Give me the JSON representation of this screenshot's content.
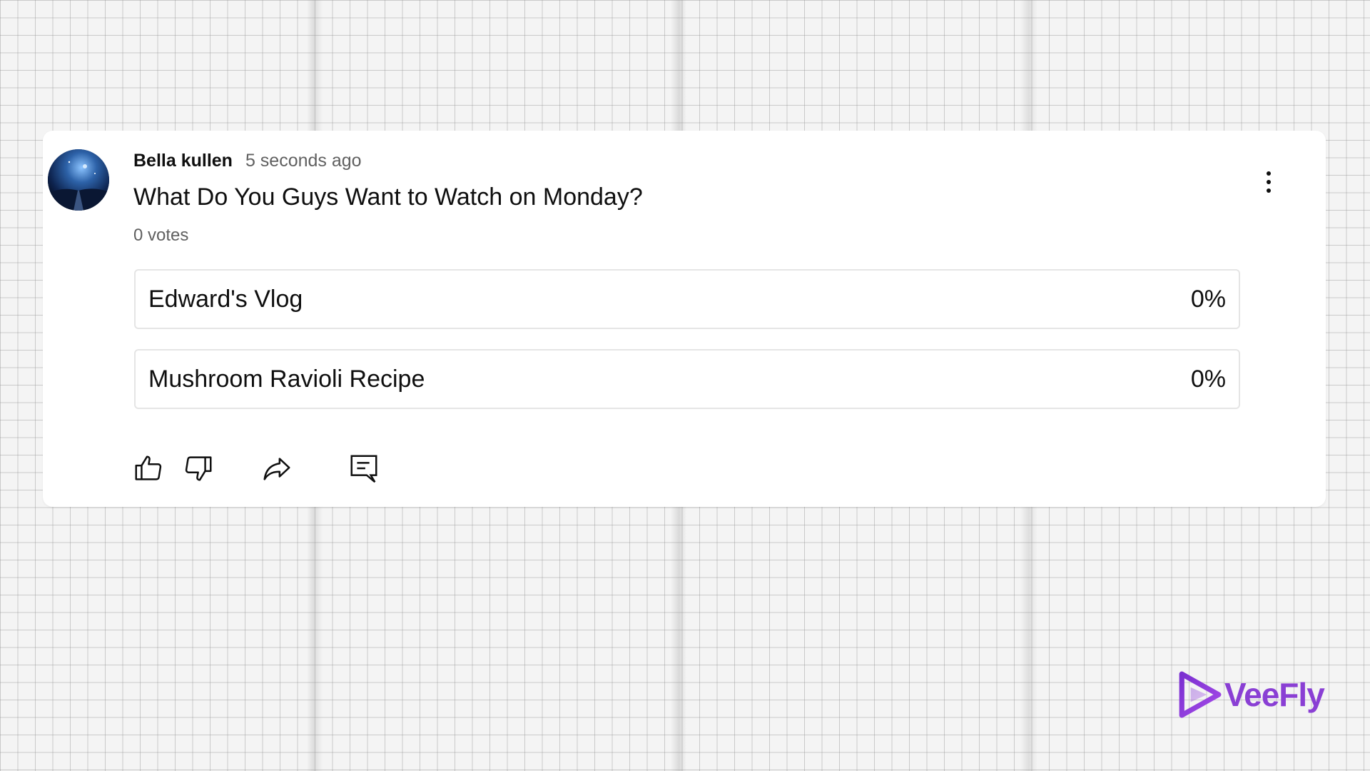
{
  "post": {
    "author": "Bella kullen",
    "timestamp": "5 seconds ago",
    "question": "What Do You Guys Want to Watch on Monday?",
    "votes": "0 votes",
    "options": [
      {
        "label": "Edward's Vlog",
        "percent": "0%"
      },
      {
        "label": "Mushroom Ravioli Recipe",
        "percent": "0%"
      }
    ]
  },
  "actions": {
    "icons": [
      "thumbs-up-icon",
      "thumbs-down-icon",
      "share-icon",
      "comment-icon"
    ]
  },
  "brand": {
    "name": "VeeFly",
    "color": "#8a3fd4"
  },
  "colors": {
    "text_primary": "#0f0f0f",
    "text_secondary": "#606060",
    "option_border": "#e5e5e5"
  }
}
